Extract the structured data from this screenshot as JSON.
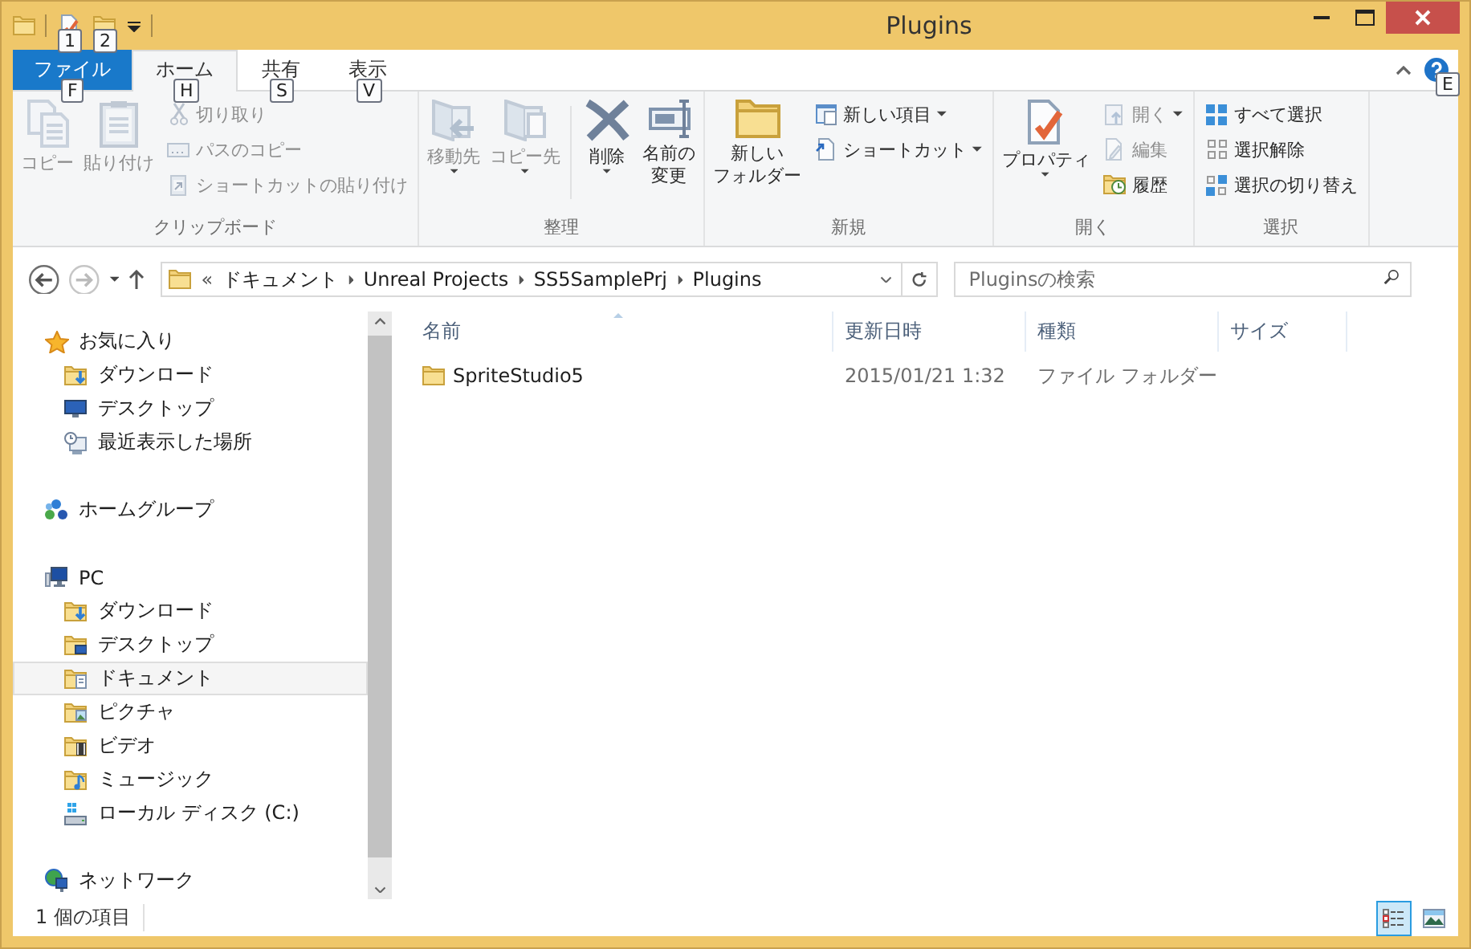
{
  "title_bar": {
    "title": "Plugins",
    "quick_access": [
      {
        "keytip": "1"
      },
      {
        "keytip": "2"
      }
    ]
  },
  "ribbon": {
    "tabs": [
      {
        "label": "ファイル",
        "kind": "file",
        "selected": false,
        "keytip": "F"
      },
      {
        "label": "ホーム",
        "kind": "tab",
        "selected": true,
        "keytip": "H"
      },
      {
        "label": "共有",
        "kind": "tab",
        "selected": false,
        "keytip": "S"
      },
      {
        "label": "表示",
        "kind": "tab",
        "selected": false,
        "keytip": "V"
      }
    ],
    "help_keytip": "E",
    "groups": [
      {
        "label": "クリップボード",
        "buttons": [
          {
            "label": [
              "コピー"
            ],
            "kind": "large",
            "disabled": true,
            "dropdown": false
          },
          {
            "label": [
              "貼り付け"
            ],
            "kind": "large",
            "disabled": true,
            "dropdown": false
          },
          {
            "kind": "stack",
            "items": [
              {
                "label": "切り取り",
                "disabled": true,
                "dropdown": false
              },
              {
                "label": "パスのコピー",
                "disabled": true,
                "dropdown": false
              },
              {
                "label": "ショートカットの貼り付け",
                "disabled": true,
                "dropdown": false
              }
            ]
          }
        ]
      },
      {
        "label": "整理",
        "buttons": [
          {
            "label": [
              "移動先"
            ],
            "kind": "large",
            "disabled": true,
            "dropdown": true
          },
          {
            "label": [
              "コピー先"
            ],
            "kind": "large",
            "disabled": true,
            "dropdown": true
          },
          {
            "kind": "divider"
          },
          {
            "label": [
              "削除"
            ],
            "kind": "large",
            "disabled": false,
            "dropdown": true
          },
          {
            "label": [
              "名前の",
              "変更"
            ],
            "kind": "large",
            "disabled": false,
            "dropdown": false
          }
        ]
      },
      {
        "label": "新規",
        "buttons": [
          {
            "label": [
              "新しい",
              "フォルダー"
            ],
            "kind": "large",
            "disabled": false,
            "dropdown": false
          },
          {
            "kind": "stack",
            "items": [
              {
                "label": "新しい項目",
                "disabled": false,
                "dropdown": true
              },
              {
                "label": "ショートカット",
                "disabled": false,
                "dropdown": true
              }
            ]
          }
        ]
      },
      {
        "label": "開く",
        "buttons": [
          {
            "label": [
              "プロパティ"
            ],
            "kind": "large",
            "disabled": false,
            "dropdown": true
          },
          {
            "kind": "stack",
            "items": [
              {
                "label": "開く",
                "disabled": true,
                "dropdown": true
              },
              {
                "label": "編集",
                "disabled": true,
                "dropdown": false
              },
              {
                "label": "履歴",
                "disabled": false,
                "dropdown": false
              }
            ]
          }
        ]
      },
      {
        "label": "選択",
        "buttons": [
          {
            "kind": "stack",
            "items": [
              {
                "label": "すべて選択",
                "disabled": false,
                "dropdown": false
              },
              {
                "label": "選択解除",
                "disabled": false,
                "dropdown": false
              },
              {
                "label": "選択の切り替え",
                "disabled": false,
                "dropdown": false
              }
            ]
          }
        ]
      }
    ]
  },
  "address_bar": {
    "overflow": "«",
    "path": [
      "ドキュメント",
      "Unreal Projects",
      "SS5SamplePrj",
      "Plugins"
    ]
  },
  "search": {
    "placeholder": "Pluginsの検索"
  },
  "navigation": {
    "items": [
      {
        "label": "お気に入り",
        "kind": "star",
        "selected": false,
        "children": [
          {
            "label": "ダウンロード",
            "kind": "download",
            "selected": false
          },
          {
            "label": "デスクトップ",
            "kind": "desktop",
            "selected": false
          },
          {
            "label": "最近表示した場所",
            "kind": "recent",
            "selected": false
          }
        ]
      },
      {
        "label": "ホームグループ",
        "kind": "homegroup",
        "selected": false
      },
      {
        "label": "PC",
        "kind": "pc",
        "selected": false,
        "children": [
          {
            "label": "ダウンロード",
            "kind": "folder-download",
            "selected": false
          },
          {
            "label": "デスクトップ",
            "kind": "folder-desktop",
            "selected": false
          },
          {
            "label": "ドキュメント",
            "kind": "folder-documents",
            "selected": true
          },
          {
            "label": "ピクチャ",
            "kind": "folder-pictures",
            "selected": false
          },
          {
            "label": "ビデオ",
            "kind": "folder-video",
            "selected": false
          },
          {
            "label": "ミュージック",
            "kind": "folder-music",
            "selected": false
          },
          {
            "label": "ローカル ディスク (C:)",
            "kind": "drive",
            "selected": false
          }
        ]
      },
      {
        "label": "ネットワーク",
        "kind": "network",
        "selected": false
      }
    ]
  },
  "file_list": {
    "columns": [
      {
        "label": "名前",
        "sorted": true
      },
      {
        "label": "更新日時",
        "sorted": false
      },
      {
        "label": "種類",
        "sorted": false
      },
      {
        "label": "サイズ",
        "sorted": false
      }
    ],
    "rows": [
      {
        "name": "SpriteStudio5",
        "modified": "2015/01/21 1:32",
        "type": "ファイル フォルダー"
      }
    ]
  },
  "status_bar": {
    "item_count": "1 個の項目",
    "views": [
      {
        "kind": "details",
        "selected": true
      },
      {
        "kind": "large-icons",
        "selected": false
      }
    ]
  }
}
